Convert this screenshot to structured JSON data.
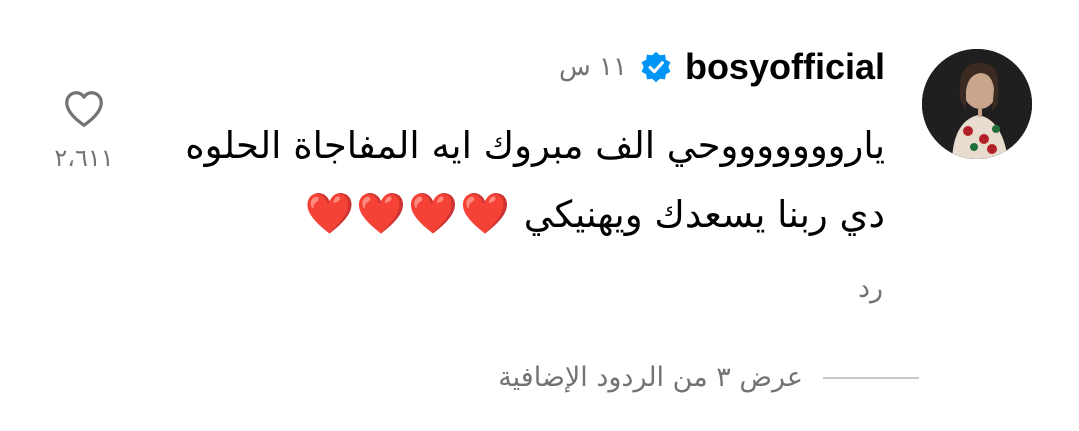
{
  "comment": {
    "username": "bosyofficial",
    "verified": true,
    "timestamp": "١١ س",
    "text_line_1": "ياروووووووحي الف مبروك ايه المفاجاة الحلوه",
    "text_line_2": "دي ربنا يسعدك ويهنيكي",
    "emoji": "❤️❤️❤️❤️",
    "reply_label": "رد",
    "like_count": "٢،٦١١",
    "view_replies_label": "عرض ٣ من الردود الإضافية"
  },
  "colors": {
    "text_primary": "#000000",
    "text_secondary": "#737373",
    "verified_badge": "#0095f6",
    "divider": "#c7c7c7",
    "heart_emoji": "#e8212f"
  },
  "icons": {
    "verified": "verified-badge-icon",
    "like": "heart-outline-icon"
  }
}
